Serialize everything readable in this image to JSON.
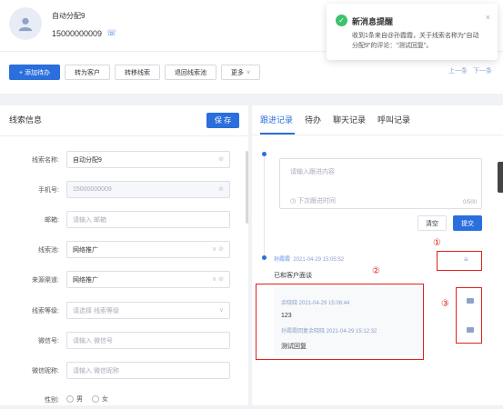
{
  "header": {
    "lead_name": "自动分配9",
    "lead_phone": "15000000009",
    "toolbar": [
      "+ 添加待办",
      "转为客户",
      "转移线索",
      "退回线索池",
      "更多"
    ],
    "pager_prev": "上一条",
    "pager_next": "下一条"
  },
  "notification": {
    "title": "新消息提醒",
    "body": "收到1条来自@孙霞霞，关于线索名称为\"自动分配9\"的评论：\"测试回复\"。"
  },
  "left_panel": {
    "title": "线索信息",
    "save_label": "保 存",
    "fields": [
      {
        "label": "线索名称:",
        "value": "自动分配9",
        "placeholder": false,
        "disabled": false,
        "suffix": "⊘"
      },
      {
        "label": "手机号:",
        "value": "15000000009",
        "placeholder": false,
        "disabled": true,
        "suffix": "⊘"
      },
      {
        "label": "邮箱:",
        "value": "请输入 邮箱",
        "placeholder": true,
        "disabled": false,
        "suffix": ""
      },
      {
        "label": "线索池:",
        "value": "网络推广",
        "placeholder": false,
        "disabled": false,
        "suffix": "∨ ⊘"
      },
      {
        "label": "来源渠道:",
        "value": "网络推广",
        "placeholder": false,
        "disabled": false,
        "suffix": "∨ ⊘"
      },
      {
        "label": "线索等级:",
        "value": "请选择 线索等级",
        "placeholder": true,
        "disabled": false,
        "suffix": "∨"
      },
      {
        "label": "微信号:",
        "value": "请输入 微信号",
        "placeholder": true,
        "disabled": false,
        "suffix": ""
      },
      {
        "label": "微信昵称:",
        "value": "请输入 微信昵称",
        "placeholder": true,
        "disabled": false,
        "suffix": ""
      }
    ],
    "gender_label": "性别:",
    "gender_options": [
      "男",
      "女"
    ]
  },
  "right_panel": {
    "tabs": [
      "跟进记录",
      "待办",
      "聊天记录",
      "呼叫记录"
    ],
    "editor_placeholder": "请输入跟进内容",
    "next_followup_placeholder": "下次跟进时间",
    "char_count": "0/500",
    "clear_label": "清空",
    "submit_label": "提交",
    "record": {
      "author": "孙霞霞",
      "time": "2021-04-29 15:05:52",
      "text": "已和客户面谈"
    },
    "replies": [
      {
        "meta": "余晓晓  2021-04-29 15:06:44",
        "text": "123"
      },
      {
        "meta": "孙霞霞回复余晓晓  2021-04-29 15:12:32",
        "text": "测试回复"
      }
    ],
    "annotations": [
      "①",
      "②",
      "③"
    ]
  },
  "colors": {
    "accent": "#2a6fdb",
    "highlight": "#e02020",
    "success": "#3ec26d"
  }
}
